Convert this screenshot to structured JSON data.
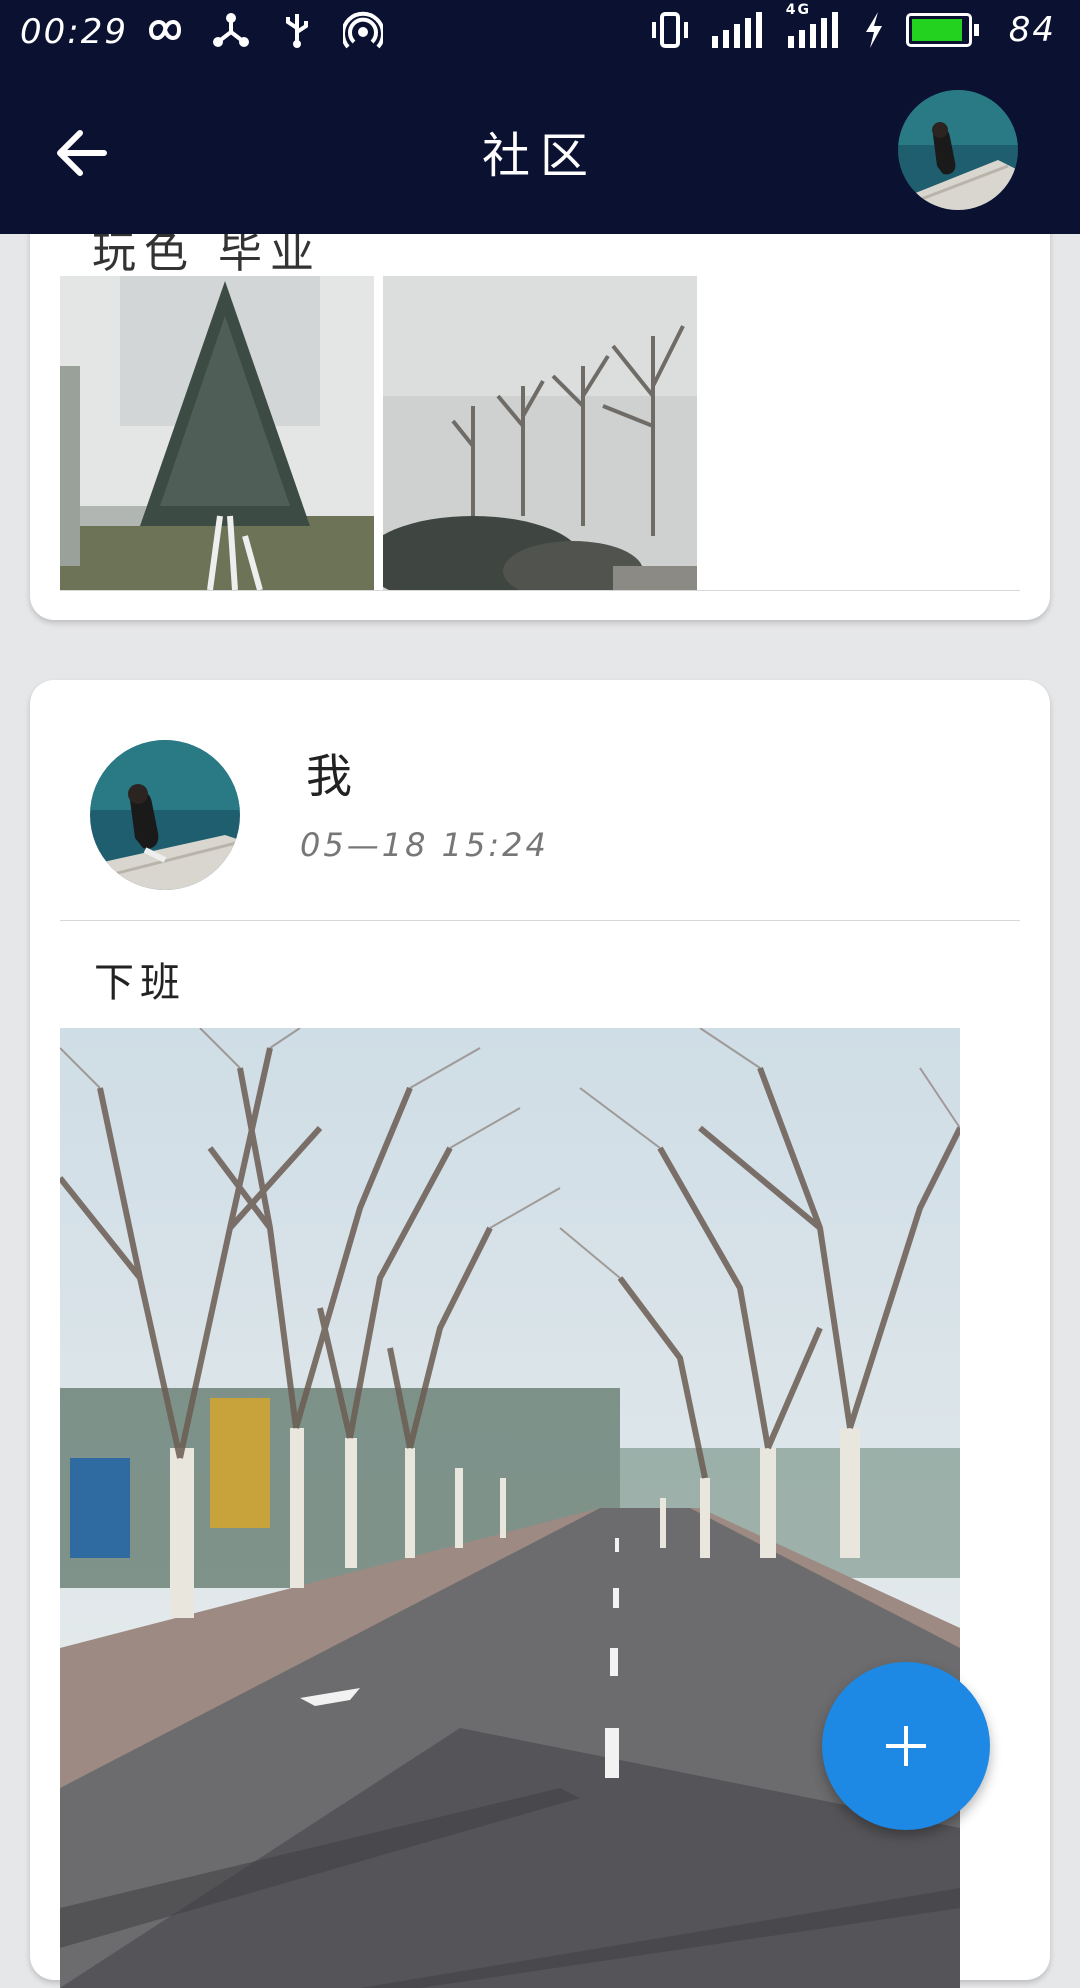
{
  "status_bar": {
    "time": "00:29",
    "battery_percent": "84",
    "battery_level": 0.84,
    "icons_left": [
      "infinity-icon",
      "share-network-icon",
      "usb-icon",
      "hotspot-icon"
    ],
    "icons_right": [
      "vibrate-icon",
      "signal-icon",
      "signal-4g-icon",
      "charging-icon",
      "battery-icon"
    ],
    "network_label": "4G"
  },
  "appbar": {
    "title": "社区",
    "back_icon": "arrow-left-icon"
  },
  "feed": {
    "post1": {
      "partial_text": "玩色 毕业",
      "images": [
        "cedar-tree-in-fog",
        "bare-trees-in-fog"
      ]
    },
    "post2": {
      "author": "我",
      "time": "05—18 15:24",
      "text": "下班",
      "image": "tree-lined-road"
    }
  },
  "fab": {
    "icon": "plus-icon"
  },
  "colors": {
    "appbar": "#0b1131",
    "background": "#e6e7e9",
    "fab": "#1e88e5",
    "battery": "#23d21f"
  }
}
